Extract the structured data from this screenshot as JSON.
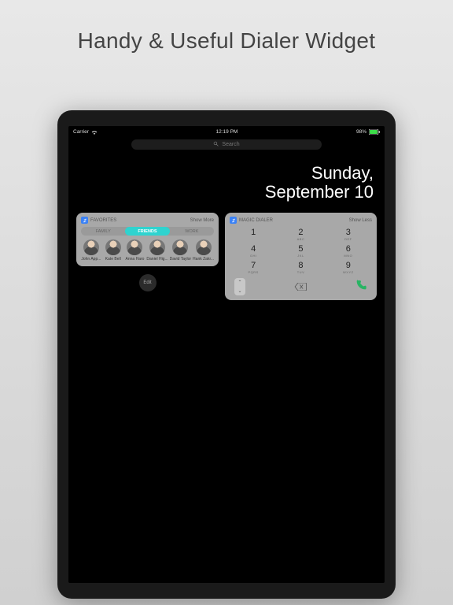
{
  "headline": "Handy & Useful Dialer Widget",
  "statusbar": {
    "carrier": "Carrier",
    "time": "12:19 PM",
    "battery": "98%"
  },
  "search": {
    "placeholder": "Search"
  },
  "date": {
    "weekday": "Sunday,",
    "month_day": "September 10"
  },
  "favorites_widget": {
    "title": "FAVORITES",
    "show_link": "Show More",
    "tabs": [
      "FAMILY",
      "FRIENDS",
      "WORK"
    ],
    "active_tab": "FRIENDS",
    "contacts": [
      {
        "name": "John App..."
      },
      {
        "name": "Kate Bell"
      },
      {
        "name": "Anna Haro"
      },
      {
        "name": "Daniel Hig..."
      },
      {
        "name": "David Taylor"
      },
      {
        "name": "Hank Zakr..."
      }
    ]
  },
  "dialer_widget": {
    "title": "MAGIC DIALER",
    "show_link": "Show Less",
    "keys": [
      {
        "num": "1",
        "sub": ""
      },
      {
        "num": "2",
        "sub": "ABC"
      },
      {
        "num": "3",
        "sub": "DEF"
      },
      {
        "num": "4",
        "sub": "GHI"
      },
      {
        "num": "5",
        "sub": "JKL"
      },
      {
        "num": "6",
        "sub": "MNO"
      },
      {
        "num": "7",
        "sub": "PQRS"
      },
      {
        "num": "8",
        "sub": "TUV"
      },
      {
        "num": "9",
        "sub": "WXYZ"
      }
    ]
  },
  "edit_label": "Edit"
}
